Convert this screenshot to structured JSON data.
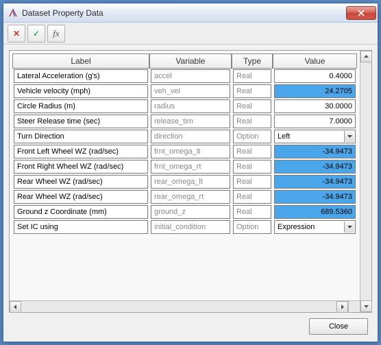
{
  "window": {
    "title": "Dataset Property Data"
  },
  "toolbar": {
    "cancel_icon": "✕",
    "apply_icon": "✓",
    "fx_icon": "fx"
  },
  "grid": {
    "headers": {
      "label": "Label",
      "variable": "Variable",
      "type": "Type",
      "value": "Value"
    },
    "rows": [
      {
        "label": "Lateral Acceleration (g's)",
        "variable": "accel",
        "type": "Real",
        "value": "0.4000",
        "highlight": false,
        "dropdown": false
      },
      {
        "label": "Vehicle velocity (mph)",
        "variable": "veh_vel",
        "type": "Real",
        "value": "24.2705",
        "highlight": true,
        "dropdown": false
      },
      {
        "label": "Circle Radius (m)",
        "variable": "radius",
        "type": "Real",
        "value": "30.0000",
        "highlight": false,
        "dropdown": false
      },
      {
        "label": "Steer Release time (sec)",
        "variable": "release_tim",
        "type": "Real",
        "value": "7.0000",
        "highlight": false,
        "dropdown": false
      },
      {
        "label": "Turn Direction",
        "variable": "direction",
        "type": "Option",
        "value": "Left",
        "highlight": false,
        "dropdown": true
      },
      {
        "label": "Front Left Wheel WZ (rad/sec)",
        "variable": "frnt_omega_lt",
        "type": "Real",
        "value": "-34.9473",
        "highlight": true,
        "dropdown": false
      },
      {
        "label": "Front Right Wheel WZ (rad/sec)",
        "variable": "frnt_omega_rt",
        "type": "Real",
        "value": "-34.9473",
        "highlight": true,
        "dropdown": false
      },
      {
        "label": "Rear Wheel WZ (rad/sec)",
        "variable": "rear_omega_lt",
        "type": "Real",
        "value": "-34.9473",
        "highlight": true,
        "dropdown": false
      },
      {
        "label": "Rear Wheel WZ (rad/sec)",
        "variable": "rear_omega_rt",
        "type": "Real",
        "value": "-34.9473",
        "highlight": true,
        "dropdown": false
      },
      {
        "label": "Ground z Coordinate (mm)",
        "variable": "ground_z",
        "type": "Real",
        "value": "689.5360",
        "highlight": true,
        "dropdown": false
      },
      {
        "label": "Set IC using",
        "variable": "initial_condition",
        "type": "Option",
        "value": "Expression",
        "highlight": false,
        "dropdown": true
      }
    ]
  },
  "footer": {
    "close_label": "Close"
  }
}
